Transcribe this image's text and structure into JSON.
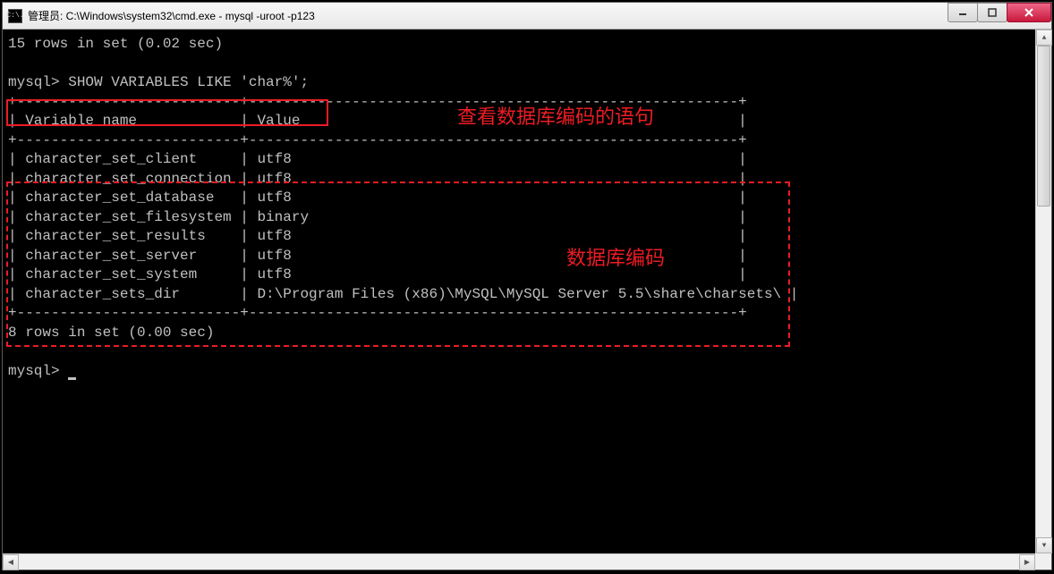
{
  "titlebar": {
    "icon_label": "C:\\.",
    "title": "管理员: C:\\Windows\\system32\\cmd.exe - mysql  -uroot -p123"
  },
  "terminal": {
    "prev_result": "15 rows in set (0.02 sec)",
    "prompt": "mysql>",
    "query": " SHOW VARIABLES LIKE 'char%';",
    "divider_top": "+--------------------------+---------------------------------------------------------+",
    "header_col1": "Variable_name",
    "header_col2": "Value",
    "rows": [
      {
        "name": "character_set_client",
        "value": "utf8"
      },
      {
        "name": "character_set_connection",
        "value": "utf8"
      },
      {
        "name": "character_set_database",
        "value": "utf8"
      },
      {
        "name": "character_set_filesystem",
        "value": "binary"
      },
      {
        "name": "character_set_results",
        "value": "utf8"
      },
      {
        "name": "character_set_server",
        "value": "utf8"
      },
      {
        "name": "character_set_system",
        "value": "utf8"
      },
      {
        "name": "character_sets_dir",
        "value": "D:\\Program Files (x86)\\MySQL\\MySQL Server 5.5\\share\\charsets\\"
      }
    ],
    "result_footer": "8 rows in set (0.00 sec)"
  },
  "annotations": {
    "query_note": "查看数据库编码的语句",
    "table_note": "数据库编码"
  }
}
